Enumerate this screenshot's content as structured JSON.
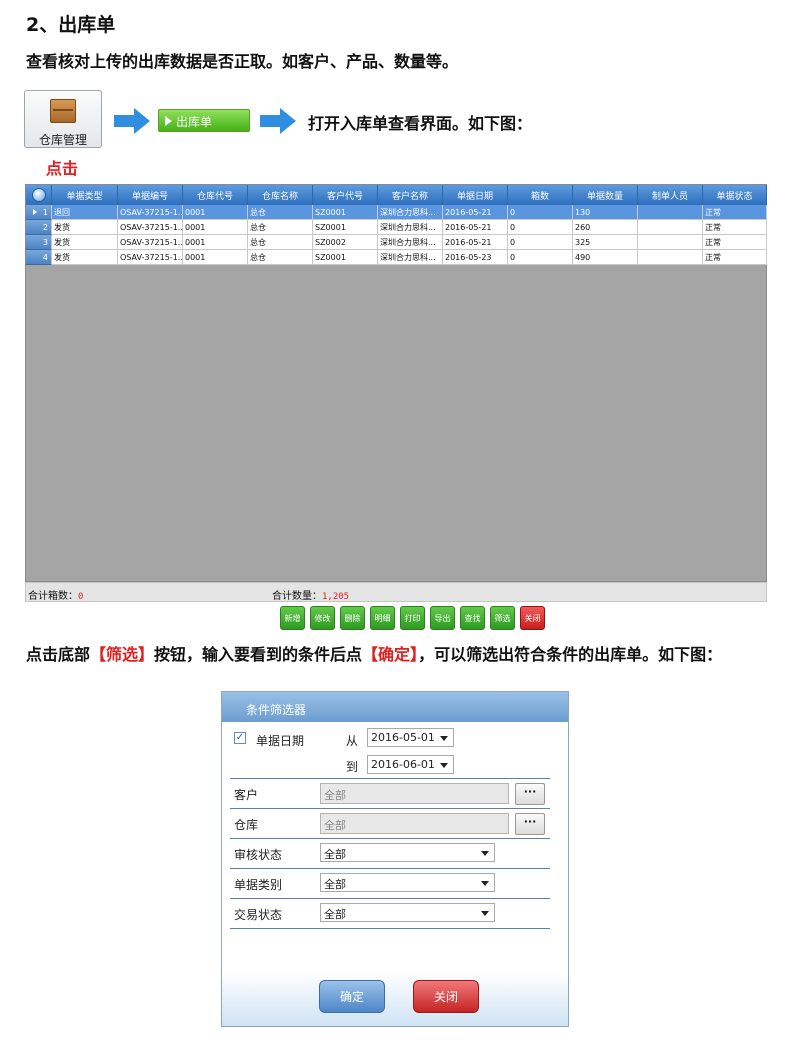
{
  "doc": {
    "heading": "2、出库单",
    "intro": "查看核对上传的出库数据是否正取。如客户、产品、数量等。",
    "step_button_label": "仓库管理",
    "click_label": "点击",
    "outbound_button_label": "出库单",
    "open_text": "打开入库单查看界面。如下图：",
    "mid_text_1": "点击底部",
    "mid_hl_1": "【筛选】",
    "mid_text_2": "按钮，输入要看到的条件后点",
    "mid_hl_2": "【确定】",
    "mid_text_3": "，可以筛选出符合条件的出库单。如下图："
  },
  "grid": {
    "columns": [
      "单据类型",
      "单据编号",
      "仓库代号",
      "仓库名称",
      "客户代号",
      "客户名称",
      "单据日期",
      "箱数",
      "单据数量",
      "制单人员",
      "单据状态"
    ],
    "rows": [
      {
        "idx": "1",
        "cells": [
          "退回",
          "OSAV-37215-1...",
          "0001",
          "总仓",
          "SZ0001",
          "深圳合力思科...",
          "2016-05-21",
          "0",
          "130",
          "",
          "正常"
        ]
      },
      {
        "idx": "2",
        "cells": [
          "发货",
          "OSAV-37215-1...",
          "0001",
          "总仓",
          "SZ0001",
          "深圳合力思科...",
          "2016-05-21",
          "0",
          "260",
          "",
          "正常"
        ]
      },
      {
        "idx": "3",
        "cells": [
          "发货",
          "OSAV-37215-1...",
          "0001",
          "总仓",
          "SZ0002",
          "深圳合力思科...",
          "2016-05-21",
          "0",
          "325",
          "",
          "正常"
        ]
      },
      {
        "idx": "4",
        "cells": [
          "发货",
          "OSAV-37215-1...",
          "0001",
          "总仓",
          "SZ0001",
          "深圳合力思科...",
          "2016-05-23",
          "0",
          "490",
          "",
          "正常"
        ]
      }
    ],
    "summary": {
      "boxes_label": "合计箱数：",
      "boxes_value": "0",
      "qty_label": "合计数量：",
      "qty_value": "1,205"
    },
    "buttons": [
      "新增",
      "修改",
      "删除",
      "明细",
      "打印",
      "导出",
      "查找",
      "筛选",
      "关闭"
    ]
  },
  "dialog": {
    "title": "条件筛选器",
    "date_label": "单据日期",
    "date_checked": "✓",
    "from_label": "从",
    "from_value": "2016-05-01",
    "to_label": "到",
    "to_value": "2016-06-01",
    "customer_label": "客户",
    "customer_value": "全部",
    "warehouse_label": "仓库",
    "warehouse_value": "全部",
    "ellipsis": "···",
    "audit_label": "审核状态",
    "audit_value": "全部",
    "doctype_label": "单据类别",
    "doctype_value": "全部",
    "trade_label": "交易状态",
    "trade_value": "全部",
    "ok": "确定",
    "close": "关闭"
  },
  "colors": {
    "accent_blue": "#2f8ee0",
    "highlight_red": "#e02020",
    "toolbar_green": "#45b116"
  }
}
